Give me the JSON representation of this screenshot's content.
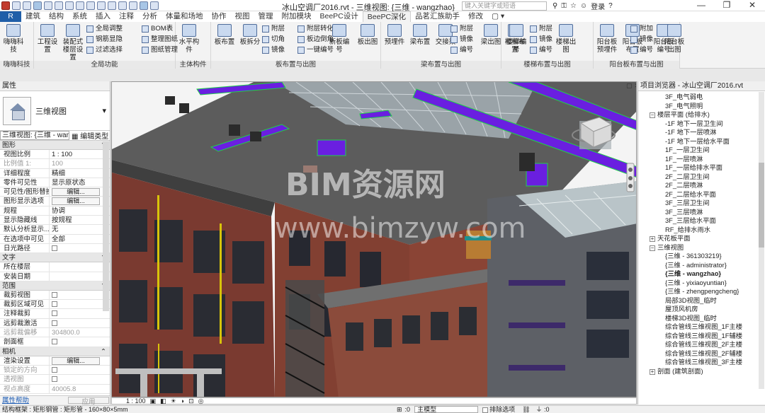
{
  "window": {
    "title": "冰山空调厂2016.rvt - 三维视图: {三维 - wangzhao}",
    "search_placeholder": "键入关键字或短语",
    "user": "登录",
    "controls": [
      "—",
      "❐",
      "✕"
    ]
  },
  "tabs": [
    "R",
    "建筑",
    "结构",
    "系统",
    "插入",
    "注释",
    "分析",
    "体量和场地",
    "协作",
    "视图",
    "管理",
    "附加模块",
    "BeePC设计",
    "BeePC深化",
    "品茗汇族助手",
    "修改",
    "▢ ▾"
  ],
  "ribbon": {
    "groups": [
      {
        "label": "嗨嗨科技",
        "buttons": [
          "嗨嗨科技"
        ]
      },
      {
        "label": "全局功能",
        "buttons": [
          "工程设置",
          "装配式楼层设置",
          "全局调整",
          "钢筋显隐",
          "过滤选择",
          "BOM表",
          "整理图纸",
          "图纸管理"
        ]
      },
      {
        "label": "主体构件",
        "buttons": [
          "水平构件"
        ]
      },
      {
        "label": "板布置与出图",
        "buttons": [
          "板布置",
          "板拆分",
          "附层",
          "切角",
          "镜像",
          "附层转化",
          "板边倒角",
          "一键编号",
          "新板编号",
          "板出图"
        ]
      },
      {
        "label": "梁布置与出图",
        "buttons": [
          "预埋件",
          "梁布置",
          "交接梁",
          "附层",
          "镜像",
          "编号",
          "梁出图"
        ]
      },
      {
        "label": "楼梯布置与出图",
        "buttons": [
          "楼梯布置",
          "楼梯编号",
          "附层",
          "镜像",
          "编号",
          "楼梯出图"
        ]
      },
      {
        "label": "阳台板布置与出图",
        "buttons": [
          "阳台板预埋件",
          "阳台板布置",
          "阳台板编号",
          "附加",
          "镜像",
          "编号",
          "阳台板出图"
        ]
      }
    ]
  },
  "properties": {
    "title": "属性",
    "type_name": "三维视图",
    "selector": "三维视图: {三维 - wan▾",
    "edit_type": "编辑类型",
    "sections": [
      {
        "name": "图形",
        "rows": [
          {
            "k": "视图比例",
            "v": "1 : 100"
          },
          {
            "k": "比例值 1:",
            "v": "100",
            "gray": true
          },
          {
            "k": "详细程度",
            "v": "精细"
          },
          {
            "k": "零件可见性",
            "v": "显示原状态"
          },
          {
            "k": "可见性/图形替换",
            "v": "编辑...",
            "btn": true
          },
          {
            "k": "图形显示选项",
            "v": "编辑...",
            "btn": true
          },
          {
            "k": "规程",
            "v": "协调"
          },
          {
            "k": "显示隐藏线",
            "v": "按规程"
          },
          {
            "k": "默认分析显示...",
            "v": "无"
          },
          {
            "k": "在选项中可见",
            "v": "全部"
          },
          {
            "k": "日光路径",
            "v": "",
            "cb": true
          }
        ]
      },
      {
        "name": "文字",
        "rows": [
          {
            "k": "所在楼层",
            "v": ""
          },
          {
            "k": "安装日期",
            "v": ""
          }
        ]
      },
      {
        "name": "范围",
        "rows": [
          {
            "k": "裁剪视图",
            "v": "",
            "cb": true
          },
          {
            "k": "裁剪区域可见",
            "v": "",
            "cb": true
          },
          {
            "k": "注释裁剪",
            "v": "",
            "cb": true
          },
          {
            "k": "远剪裁激活",
            "v": "",
            "cb": true
          },
          {
            "k": "远剪裁偏移",
            "v": "304800.0",
            "gray": true
          },
          {
            "k": "剖面框",
            "v": "",
            "cb": true
          }
        ]
      },
      {
        "name": "相机",
        "rows": [
          {
            "k": "渲染设置",
            "v": "编辑...",
            "btn": true
          },
          {
            "k": "锁定的方向",
            "v": "",
            "cb": true,
            "gray": true
          },
          {
            "k": "透视图",
            "v": "",
            "cb": true,
            "gray": true
          },
          {
            "k": "视点高度",
            "v": "40005.8",
            "gray": true
          }
        ]
      }
    ],
    "help": "属性帮助",
    "apply": "应用"
  },
  "viewport": {
    "watermark1": "BIM资源网",
    "watermark2": "www.bimzyw.com",
    "scale": "1 : 100"
  },
  "browser": {
    "title": "项目浏览器 - 冰山空调厂2016.rvt",
    "items": [
      {
        "t": "3F_电气弱电",
        "l": 3
      },
      {
        "t": "3F_电气照明",
        "l": 3
      },
      {
        "t": "楼层平面 (给排水)",
        "l": 1,
        "tog": "−"
      },
      {
        "t": "-1F 地下一层卫生间",
        "l": 3
      },
      {
        "t": "-1F 地下一层喷淋",
        "l": 3
      },
      {
        "t": "-1F 地下一层给水平面",
        "l": 3
      },
      {
        "t": "1F_一层卫生间",
        "l": 3
      },
      {
        "t": "1F_一层喷淋",
        "l": 3
      },
      {
        "t": "1F_一层给排水平面",
        "l": 3
      },
      {
        "t": "2F_二层卫生间",
        "l": 3
      },
      {
        "t": "2F_二层喷淋",
        "l": 3
      },
      {
        "t": "2F_二层给水平面",
        "l": 3
      },
      {
        "t": "3F_三层卫生间",
        "l": 3
      },
      {
        "t": "3F_三层喷淋",
        "l": 3
      },
      {
        "t": "3F_三层给水平面",
        "l": 3
      },
      {
        "t": "RF_给排水雨水",
        "l": 3
      },
      {
        "t": "天花板平面",
        "l": 1,
        "tog": "+"
      },
      {
        "t": "三维视图",
        "l": 1,
        "tog": "−"
      },
      {
        "t": "{三维 - 361303219}",
        "l": 3
      },
      {
        "t": "{三维 - administrator}",
        "l": 3
      },
      {
        "t": "{三维 - wangzhao}",
        "l": 3,
        "sel": true
      },
      {
        "t": "{三维 - yixiaoyuntian}",
        "l": 3
      },
      {
        "t": "{三维 - zhengpengcheng}",
        "l": 3
      },
      {
        "t": "局部3D视图_临时",
        "l": 3
      },
      {
        "t": "屋顶风机房",
        "l": 3
      },
      {
        "t": "楼梯3D视图_临时",
        "l": 3
      },
      {
        "t": "综合管线三维视图_1F主楼",
        "l": 3
      },
      {
        "t": "综合管线三维视图_1F辅楼",
        "l": 3
      },
      {
        "t": "综合管线三维视图_2F主楼",
        "l": 3
      },
      {
        "t": "综合管线三维视图_2F辅楼",
        "l": 3
      },
      {
        "t": "综合管线三维视图_3F主楼",
        "l": 3
      },
      {
        "t": "剖面 (建筑剖面)",
        "l": 1,
        "tog": "+"
      }
    ]
  },
  "status": {
    "text": "结构框架 : 矩形钢管 : 矩形管 - 160×80×5mm",
    "model": "主模型",
    "exclude": "排除选项",
    "zero": ":0"
  },
  "colors": {
    "pipe": "#6a1fe0",
    "duct_edge": "#1fd14a",
    "brick": "#7a3a30",
    "roof": "#5a5a5a"
  }
}
